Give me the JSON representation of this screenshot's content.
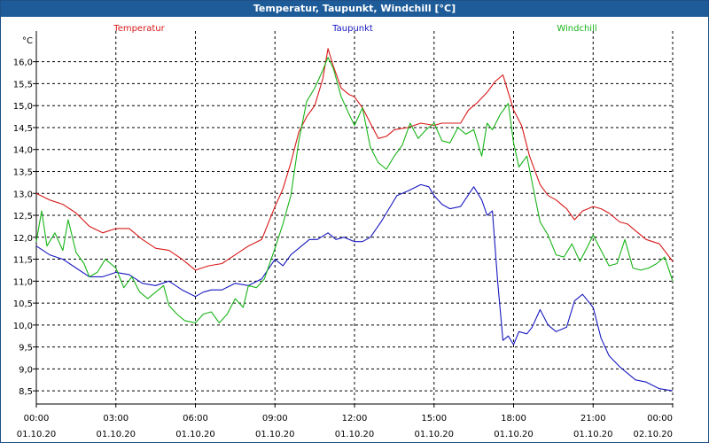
{
  "window": {
    "title": "Temperatur, Taupunkt, Windchill [°C]"
  },
  "chart_data": {
    "type": "line",
    "title": "Temperatur, Taupunkt, Windchill [°C]",
    "ylabel": "°C",
    "ylim": [
      8.2,
      16.7
    ],
    "xlim": [
      0,
      24
    ],
    "grid": true,
    "x_ticks": [
      {
        "pos": 0,
        "time": "00:00",
        "date": "01.10.20"
      },
      {
        "pos": 3,
        "time": "03:00",
        "date": "01.10.20"
      },
      {
        "pos": 6,
        "time": "06:00",
        "date": "01.10.20"
      },
      {
        "pos": 9,
        "time": "09:00",
        "date": "01.10.20"
      },
      {
        "pos": 12,
        "time": "12:00",
        "date": "01.10.20"
      },
      {
        "pos": 15,
        "time": "15:00",
        "date": "01.10.20"
      },
      {
        "pos": 18,
        "time": "18:00",
        "date": "01.10.20"
      },
      {
        "pos": 21,
        "time": "21:00",
        "date": "01.10.20"
      },
      {
        "pos": 24,
        "time": "00:00",
        "date": "02.10.20"
      }
    ],
    "y_ticks": [
      "8,5",
      "9,0",
      "9,5",
      "10,0",
      "10,5",
      "11,0",
      "11,5",
      "12,0",
      "12,5",
      "13,0",
      "13,5",
      "14,0",
      "14,5",
      "15,0",
      "15,5",
      "16,0"
    ],
    "y_tick_values": [
      8.5,
      9.0,
      9.5,
      10.0,
      10.5,
      11.0,
      11.5,
      12.0,
      12.5,
      13.0,
      13.5,
      14.0,
      14.5,
      15.0,
      15.5,
      16.0
    ],
    "series": [
      {
        "name": "Temperatur",
        "color": "#d81818",
        "x": [
          0,
          0.5,
          1,
          1.5,
          2,
          2.5,
          3,
          3.5,
          4,
          4.5,
          5,
          5.5,
          6,
          6.5,
          7,
          7.5,
          8,
          8.5,
          9,
          9.3,
          9.6,
          9.9,
          10.2,
          10.5,
          10.8,
          11,
          11.2,
          11.5,
          11.8,
          12,
          12.3,
          12.6,
          12.9,
          13.2,
          13.5,
          14,
          14.5,
          15,
          15.3,
          15.6,
          16,
          16.3,
          16.6,
          17,
          17.3,
          17.6,
          17.8,
          18,
          18.3,
          18.6,
          19,
          19.3,
          19.6,
          20,
          20.3,
          20.6,
          21,
          21.3,
          21.6,
          22,
          22.3,
          22.6,
          23,
          23.5,
          24
        ],
        "y": [
          13.0,
          12.85,
          12.75,
          12.55,
          12.25,
          12.1,
          12.2,
          12.2,
          11.95,
          11.75,
          11.7,
          11.5,
          11.25,
          11.35,
          11.4,
          11.6,
          11.8,
          11.95,
          12.7,
          13.1,
          13.7,
          14.4,
          14.75,
          15.0,
          15.6,
          16.3,
          15.9,
          15.4,
          15.25,
          15.2,
          14.95,
          14.6,
          14.25,
          14.3,
          14.45,
          14.5,
          14.6,
          14.55,
          14.6,
          14.6,
          14.6,
          14.9,
          15.05,
          15.3,
          15.55,
          15.7,
          15.3,
          14.9,
          14.55,
          13.85,
          13.2,
          12.95,
          12.85,
          12.65,
          12.4,
          12.6,
          12.7,
          12.65,
          12.55,
          12.35,
          12.3,
          12.15,
          11.95,
          11.85,
          11.45
        ]
      },
      {
        "name": "Taupunkt",
        "color": "#1818c0",
        "x": [
          0,
          0.5,
          1,
          1.5,
          2,
          2.5,
          3,
          3.5,
          4,
          4.5,
          5,
          5.5,
          6,
          6.3,
          6.6,
          7,
          7.5,
          8,
          8.5,
          9,
          9.3,
          9.6,
          10,
          10.3,
          10.6,
          11,
          11.3,
          11.6,
          12,
          12.3,
          12.6,
          13,
          13.3,
          13.6,
          14,
          14.5,
          14.8,
          15,
          15.3,
          15.6,
          16,
          16.5,
          16.8,
          17,
          17.2,
          17.4,
          17.6,
          17.8,
          18,
          18.2,
          18.5,
          18.7,
          19,
          19.3,
          19.6,
          20,
          20.3,
          20.6,
          21,
          21.3,
          21.6,
          22,
          22.3,
          22.6,
          23,
          23.5,
          24
        ],
        "y": [
          11.8,
          11.6,
          11.5,
          11.3,
          11.1,
          11.1,
          11.2,
          11.15,
          10.95,
          10.9,
          11.0,
          10.8,
          10.65,
          10.75,
          10.8,
          10.8,
          10.95,
          10.9,
          11.05,
          11.5,
          11.35,
          11.6,
          11.8,
          11.95,
          11.95,
          12.1,
          11.95,
          12.0,
          11.9,
          11.9,
          12.0,
          12.35,
          12.65,
          12.95,
          13.05,
          13.2,
          13.15,
          12.95,
          12.75,
          12.65,
          12.7,
          13.15,
          12.85,
          12.5,
          12.6,
          11.0,
          9.65,
          9.75,
          9.55,
          9.85,
          9.8,
          9.95,
          10.35,
          10.0,
          9.85,
          9.95,
          10.55,
          10.7,
          10.4,
          9.7,
          9.3,
          9.05,
          8.9,
          8.75,
          8.7,
          8.55,
          8.5
        ]
      },
      {
        "name": "Windchill",
        "color": "#18b418",
        "x": [
          0,
          0.2,
          0.4,
          0.7,
          1,
          1.2,
          1.5,
          1.8,
          2,
          2.3,
          2.6,
          3,
          3.3,
          3.6,
          3.9,
          4.2,
          4.5,
          4.8,
          5,
          5.3,
          5.6,
          6,
          6.3,
          6.6,
          6.9,
          7.2,
          7.5,
          7.8,
          8,
          8.3,
          8.6,
          9,
          9.3,
          9.6,
          9.9,
          10.2,
          10.5,
          10.8,
          11,
          11.2,
          11.5,
          11.8,
          12,
          12.3,
          12.6,
          12.9,
          13.2,
          13.5,
          13.8,
          14.1,
          14.4,
          14.7,
          15,
          15.3,
          15.6,
          15.9,
          16.2,
          16.5,
          16.8,
          17,
          17.2,
          17.5,
          17.8,
          18,
          18.2,
          18.5,
          18.8,
          19,
          19.3,
          19.6,
          19.9,
          20.2,
          20.5,
          20.8,
          21,
          21.3,
          21.6,
          21.9,
          22.2,
          22.5,
          22.8,
          23.1,
          23.4,
          23.7,
          24
        ],
        "y": [
          11.9,
          12.6,
          11.8,
          12.1,
          11.7,
          12.4,
          11.65,
          11.4,
          11.1,
          11.2,
          11.5,
          11.3,
          10.85,
          11.1,
          10.75,
          10.6,
          10.75,
          10.9,
          10.45,
          10.25,
          10.1,
          10.05,
          10.25,
          10.3,
          10.05,
          10.25,
          10.6,
          10.4,
          10.9,
          10.85,
          11.05,
          11.75,
          12.3,
          12.95,
          14.2,
          15.1,
          15.4,
          15.8,
          16.1,
          15.85,
          15.2,
          14.8,
          14.55,
          14.95,
          14.05,
          13.7,
          13.55,
          13.85,
          14.1,
          14.6,
          14.25,
          14.45,
          14.6,
          14.2,
          14.15,
          14.5,
          14.35,
          14.45,
          13.85,
          14.6,
          14.45,
          14.8,
          15.05,
          14.15,
          13.6,
          13.85,
          12.95,
          12.35,
          12.05,
          11.6,
          11.55,
          11.85,
          11.45,
          11.8,
          12.05,
          11.7,
          11.35,
          11.4,
          11.95,
          11.3,
          11.25,
          11.3,
          11.4,
          11.55,
          11.0
        ]
      }
    ]
  }
}
